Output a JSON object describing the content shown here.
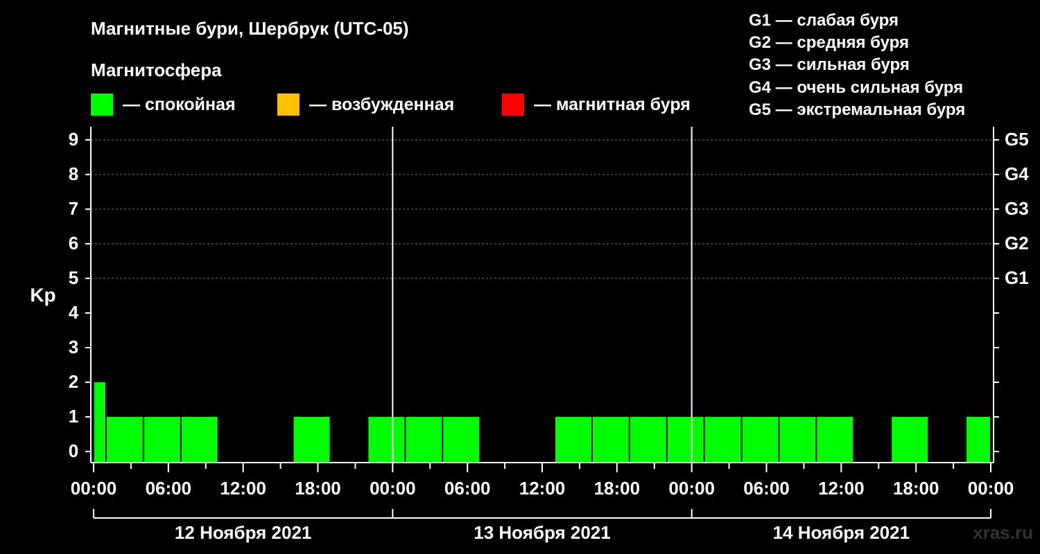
{
  "title": "Магнитные бури, Шербрук (UTC-05)",
  "subtitle": "Магнитосфера",
  "legend": [
    {
      "label": "— спокойная",
      "color": "#00ff00"
    },
    {
      "label": "— возбужденная",
      "color": "#ffc000"
    },
    {
      "label": "— магнитная буря",
      "color": "#ff0000"
    }
  ],
  "g_legend": [
    "G1 — слабая буря",
    "G2 — средняя буря",
    "G3 — сильная буря",
    "G4 — очень сильная буря",
    "G5 — экстремальная буря"
  ],
  "watermark": "xras.ru",
  "chart_data": {
    "type": "bar",
    "ylabel": "Kp",
    "ylim": [
      0,
      9
    ],
    "yticks": [
      0,
      1,
      2,
      3,
      4,
      5,
      6,
      7,
      8,
      9
    ],
    "right_ticks": [
      {
        "value": 5,
        "label": "G1"
      },
      {
        "value": 6,
        "label": "G2"
      },
      {
        "value": 7,
        "label": "G3"
      },
      {
        "value": 8,
        "label": "G4"
      },
      {
        "value": 9,
        "label": "G5"
      }
    ],
    "x_tick_labels": [
      "00:00",
      "06:00",
      "12:00",
      "18:00",
      "00:00",
      "06:00",
      "12:00",
      "18:00",
      "00:00",
      "06:00",
      "12:00",
      "18:00",
      "00:00"
    ],
    "x_range_hours": [
      0,
      72
    ],
    "days": [
      "12 Ноября 2021",
      "13 Ноября 2021",
      "14 Ноября 2021"
    ],
    "bar_color": "#00ff00",
    "bars": [
      {
        "start": 0,
        "end": 1,
        "kp": 2
      },
      {
        "start": 1,
        "end": 4,
        "kp": 1
      },
      {
        "start": 4,
        "end": 7,
        "kp": 1
      },
      {
        "start": 7,
        "end": 10,
        "kp": 1
      },
      {
        "start": 10,
        "end": 13,
        "kp": 0
      },
      {
        "start": 13,
        "end": 16,
        "kp": 0
      },
      {
        "start": 16,
        "end": 19,
        "kp": 1
      },
      {
        "start": 19,
        "end": 22,
        "kp": 0
      },
      {
        "start": 22,
        "end": 25,
        "kp": 1
      },
      {
        "start": 25,
        "end": 28,
        "kp": 1
      },
      {
        "start": 28,
        "end": 31,
        "kp": 1
      },
      {
        "start": 31,
        "end": 34,
        "kp": 0
      },
      {
        "start": 34,
        "end": 37,
        "kp": 0
      },
      {
        "start": 37,
        "end": 40,
        "kp": 1
      },
      {
        "start": 40,
        "end": 43,
        "kp": 1
      },
      {
        "start": 43,
        "end": 46,
        "kp": 1
      },
      {
        "start": 46,
        "end": 49,
        "kp": 1
      },
      {
        "start": 49,
        "end": 52,
        "kp": 1
      },
      {
        "start": 52,
        "end": 55,
        "kp": 1
      },
      {
        "start": 55,
        "end": 58,
        "kp": 1
      },
      {
        "start": 58,
        "end": 61,
        "kp": 1
      },
      {
        "start": 61,
        "end": 64,
        "kp": 0
      },
      {
        "start": 64,
        "end": 67,
        "kp": 1
      },
      {
        "start": 67,
        "end": 70,
        "kp": 0
      },
      {
        "start": 70,
        "end": 72,
        "kp": 1
      }
    ]
  }
}
